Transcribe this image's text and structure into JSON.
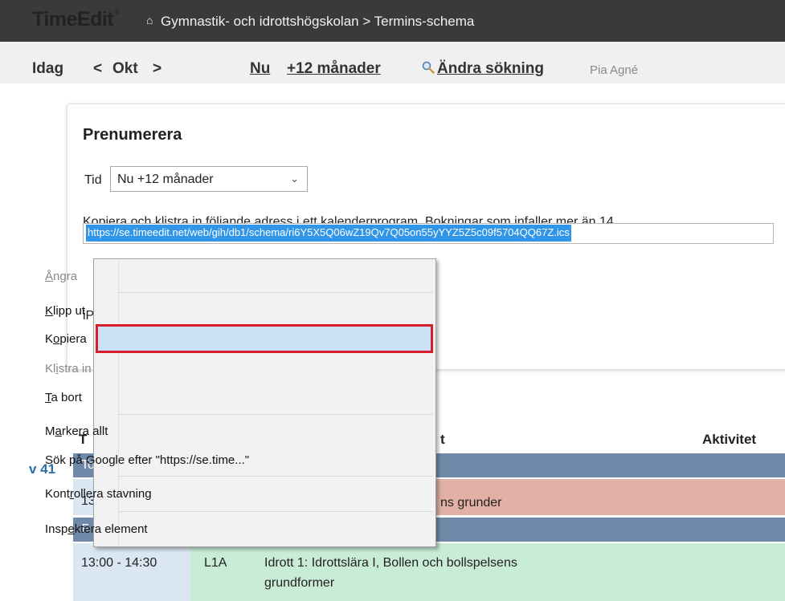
{
  "header": {
    "logo": "TimeEdit",
    "logo_mark": "®",
    "breadcrumb": "Gymnastik- och idrottshögskolan > Termins-schema"
  },
  "toolbar": {
    "today": "Idag",
    "prev": "<",
    "month": "Okt",
    "next": ">",
    "now": "Nu",
    "range": "+12 månader",
    "change_search": "Ändra sökning",
    "user": "Pia Agné"
  },
  "subscribe": {
    "title": "Prenumerera",
    "tid_label": "Tid",
    "tid_value": "Nu +12 månader",
    "info": "Kopiera och klistra in följande adress i ett kalenderprogram. Bokningar som infaller mer än 14",
    "url": "https://se.timeedit.net/web/gih/db1/schema/ri6Y5X5Q06wZ19Qv7Q05on55yYYZ5Z5c09f5704QQ67Z.ics",
    "ip_text": "iP"
  },
  "schedule": {
    "col_time": "T",
    "col_mid": "t",
    "col_activity": "Aktivitet",
    "week": "v 41",
    "day1": "To",
    "row1_time": "13",
    "row1_activity": "ns grunder",
    "day2": "F",
    "row2_time": "13:00 - 14:30",
    "row2_group": "L1A",
    "row2_activity_line1": "Idrott 1: Idrottslära I, Bollen och bollspelsens",
    "row2_activity_line2": "grundformer"
  },
  "context_menu": {
    "undo": "Ångra",
    "cut": "Klipp ut",
    "copy": "Kopiera",
    "paste": "Klistra in",
    "delete": "Ta bort",
    "select_all": "Markera allt",
    "search_google": "Sök på Google efter \"https://se.time...\"",
    "spellcheck": "Kontrollera stavning",
    "inspect": "Inspektera element"
  },
  "colors": {
    "topbar": "#3a3a3a",
    "toolbar": "#f0f0f0",
    "selection": "#3296e8",
    "dayrow": "#6f8aa8",
    "row1_bg": "#e2b0a4",
    "row2_bg": "#c9ecd6",
    "highlight_border": "#d81e28"
  }
}
